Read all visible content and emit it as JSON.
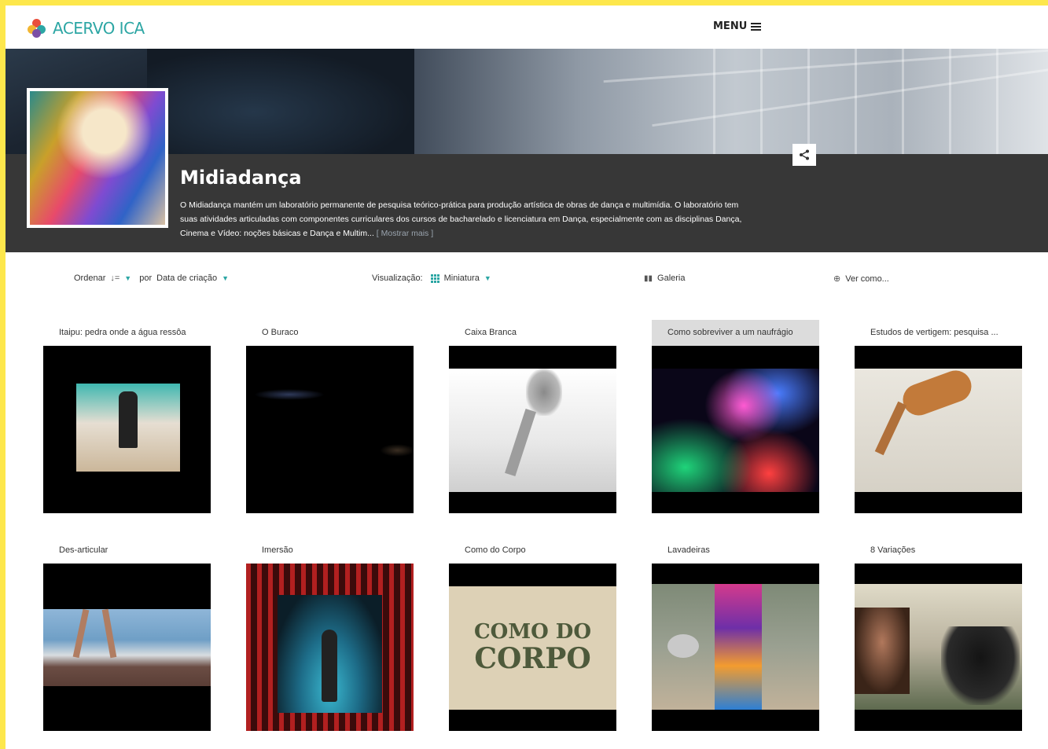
{
  "header": {
    "logo_text": "ACERVO ICA",
    "menu_label": "MENU"
  },
  "collection": {
    "title": "Midiadança",
    "description": "O Midiadança mantém um laboratório permanente de pesquisa teórico-prática para produção artística de obras de dança e multimídia. O laboratório tem suas atividades articuladas com componentes curriculares dos cursos de bacharelado e licenciatura em Dança, especialmente com as disciplinas Dança, Cinema e Vídeo: noções básicas e Dança e Multim...",
    "show_more": "[ Mostrar mais ]"
  },
  "toolbar": {
    "sort_label": "Ordenar",
    "by_label": "por",
    "sort_value": "Data de criação",
    "view_label": "Visualização:",
    "view_value": "Miniatura",
    "gallery_label": "Galeria",
    "view_as_label": "Ver como..."
  },
  "items": [
    {
      "title": "Itaipu: pedra onde a água ressôa"
    },
    {
      "title": "O Buraco"
    },
    {
      "title": "Caixa Branca"
    },
    {
      "title": "Como sobreviver a um naufrágio"
    },
    {
      "title": "Estudos de vertigem: pesquisa ..."
    },
    {
      "title": "Des-articular"
    },
    {
      "title": "Imersão"
    },
    {
      "title": "Como do Corpo",
      "thumb_text_line1": "COMO DO",
      "thumb_text_line2": "CORPO"
    },
    {
      "title": "Lavadeiras"
    },
    {
      "title": "8 Variações"
    }
  ],
  "colors": {
    "accent": "#2ca6a4",
    "frame": "#fde74c",
    "collection_bar": "#373737"
  }
}
